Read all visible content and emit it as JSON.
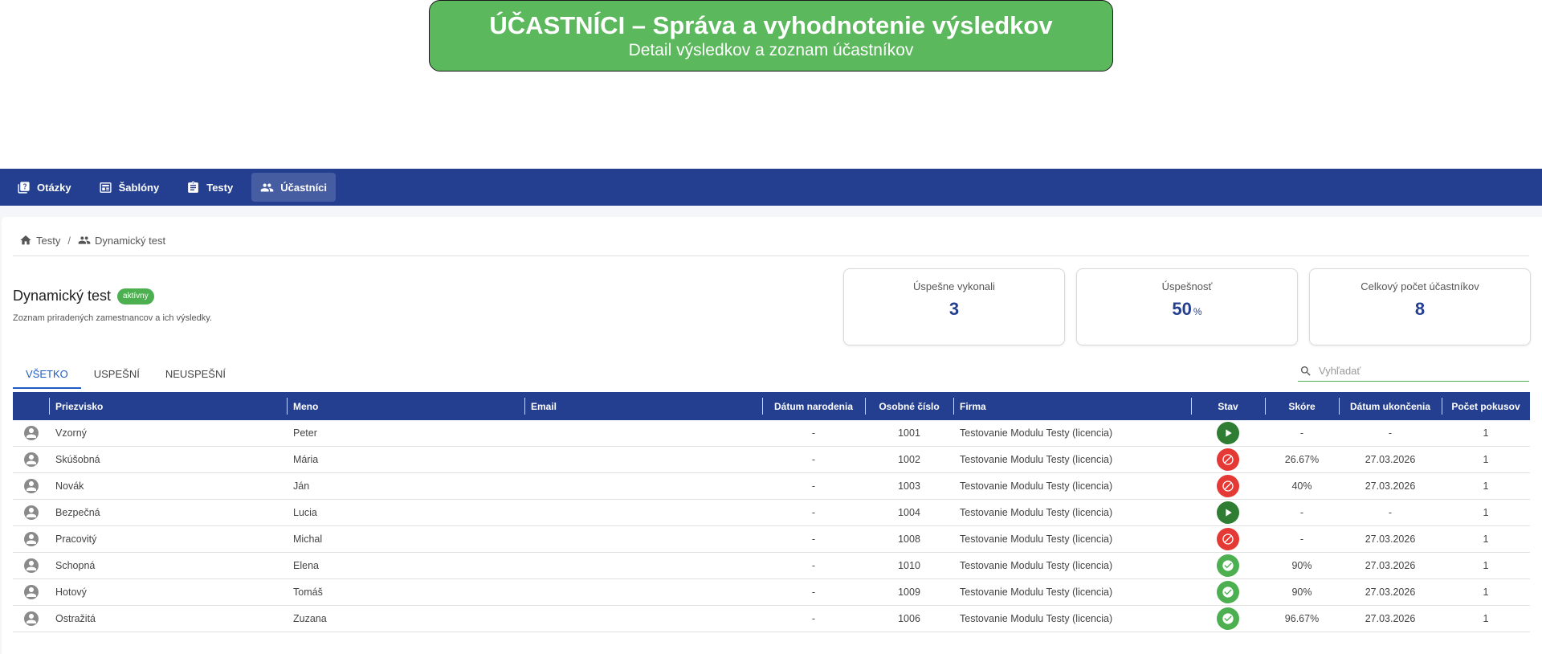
{
  "banner": {
    "title": "ÚČASTNÍCI – Správa a vyhodnotenie výsledkov",
    "subtitle": "Detail výsledkov a zoznam účastníkov"
  },
  "nav": {
    "items": [
      {
        "label": "Otázky",
        "icon": "question-book-icon"
      },
      {
        "label": "Šablóny",
        "icon": "template-icon"
      },
      {
        "label": "Testy",
        "icon": "clipboard-icon"
      },
      {
        "label": "Účastníci",
        "icon": "people-icon",
        "active": true
      }
    ]
  },
  "breadcrumb": {
    "home": "Testy",
    "separator": "/",
    "current": "Dynamický test"
  },
  "page": {
    "title": "Dynamický test",
    "status": "aktívny",
    "description": "Zoznam priradených zamestnancov a ich výsledky."
  },
  "stats": {
    "passed_label": "Úspešne vykonali",
    "passed_value": "3",
    "rate_label": "Úspešnosť",
    "rate_value": "50",
    "rate_unit": "%",
    "total_label": "Celkový počet účastníkov",
    "total_value": "8"
  },
  "tabs": [
    "VŠETKO",
    "USPEŠNÍ",
    "NEUSPEŠNÍ"
  ],
  "search": {
    "placeholder": "Vyhľadať"
  },
  "table": {
    "headers": {
      "surname": "Priezvisko",
      "name": "Meno",
      "email": "Email",
      "birth": "Dátum narodenia",
      "personal": "Osobné číslo",
      "company": "Firma",
      "status": "Stav",
      "score": "Skóre",
      "finished": "Dátum ukončenia",
      "attempts": "Počet pokusov"
    },
    "rows": [
      {
        "surname": "Vzorný",
        "name": "Peter",
        "email": "",
        "birth": "-",
        "personal": "1001",
        "company": "Testovanie Modulu Testy (licencia)",
        "status": "in-progress",
        "score": "-",
        "finished": "-",
        "attempts": "1"
      },
      {
        "surname": "Skúšobná",
        "name": "Mária",
        "email": "",
        "birth": "-",
        "personal": "1002",
        "company": "Testovanie Modulu Testy (licencia)",
        "status": "failed",
        "score": "26.67%",
        "finished": "27.03.2026",
        "attempts": "1"
      },
      {
        "surname": "Novák",
        "name": "Ján",
        "email": "",
        "birth": "-",
        "personal": "1003",
        "company": "Testovanie Modulu Testy (licencia)",
        "status": "failed",
        "score": "40%",
        "finished": "27.03.2026",
        "attempts": "1"
      },
      {
        "surname": "Bezpečná",
        "name": "Lucia",
        "email": "",
        "birth": "-",
        "personal": "1004",
        "company": "Testovanie Modulu Testy (licencia)",
        "status": "in-progress",
        "score": "-",
        "finished": "-",
        "attempts": "1"
      },
      {
        "surname": "Pracovitý",
        "name": "Michal",
        "email": "",
        "birth": "-",
        "personal": "1008",
        "company": "Testovanie Modulu Testy (licencia)",
        "status": "failed",
        "score": "-",
        "finished": "27.03.2026",
        "attempts": "1"
      },
      {
        "surname": "Schopná",
        "name": "Elena",
        "email": "",
        "birth": "-",
        "personal": "1010",
        "company": "Testovanie Modulu Testy (licencia)",
        "status": "passed",
        "score": "90%",
        "finished": "27.03.2026",
        "attempts": "1"
      },
      {
        "surname": "Hotový",
        "name": "Tomáš",
        "email": "",
        "birth": "-",
        "personal": "1009",
        "company": "Testovanie Modulu Testy (licencia)",
        "status": "passed",
        "score": "90%",
        "finished": "27.03.2026",
        "attempts": "1"
      },
      {
        "surname": "Ostražitá",
        "name": "Zuzana",
        "email": "",
        "birth": "-",
        "personal": "1006",
        "company": "Testovanie Modulu Testy (licencia)",
        "status": "passed",
        "score": "96.67%",
        "finished": "27.03.2026",
        "attempts": "1"
      }
    ]
  },
  "colors": {
    "primary": "#243f8f",
    "banner": "#5cb85c",
    "success": "#4caf50",
    "in_progress": "#2e7d32",
    "fail": "#e53935",
    "tab_active": "#1e5bc6"
  }
}
